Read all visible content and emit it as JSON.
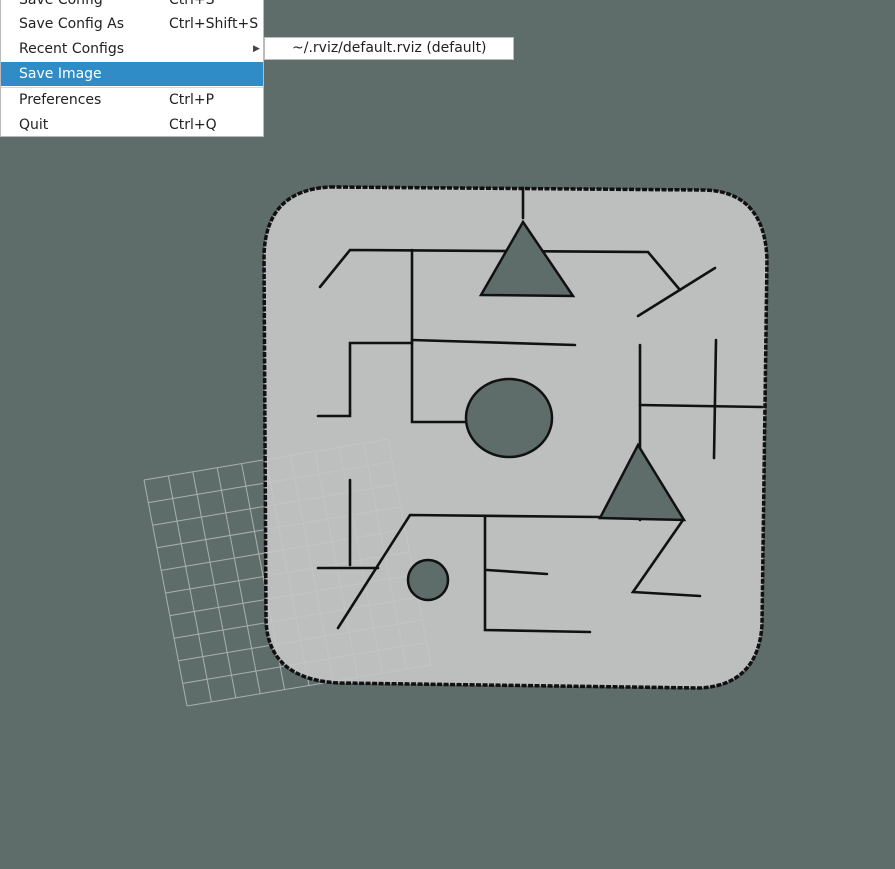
{
  "viewport": {
    "background": "#5f6d6a",
    "map_free_color": "#c5c5c5",
    "wall_color": "#111111",
    "grid_color": "#a9b0ad"
  },
  "menu": {
    "items": [
      {
        "label": "Save Config",
        "shortcut": "Ctrl+S"
      },
      {
        "label": "Save Config As",
        "shortcut": "Ctrl+Shift+S"
      },
      {
        "label": "Recent Configs",
        "shortcut": ""
      },
      {
        "label": "Save Image",
        "shortcut": ""
      },
      {
        "label": "Preferences",
        "shortcut": "Ctrl+P"
      },
      {
        "label": "Quit",
        "shortcut": "Ctrl+Q"
      }
    ],
    "selected": "Save Image",
    "selected_color": "#308cc6"
  },
  "submenu": {
    "items": [
      {
        "label": "~/.rviz/default.rviz (default)"
      }
    ]
  }
}
